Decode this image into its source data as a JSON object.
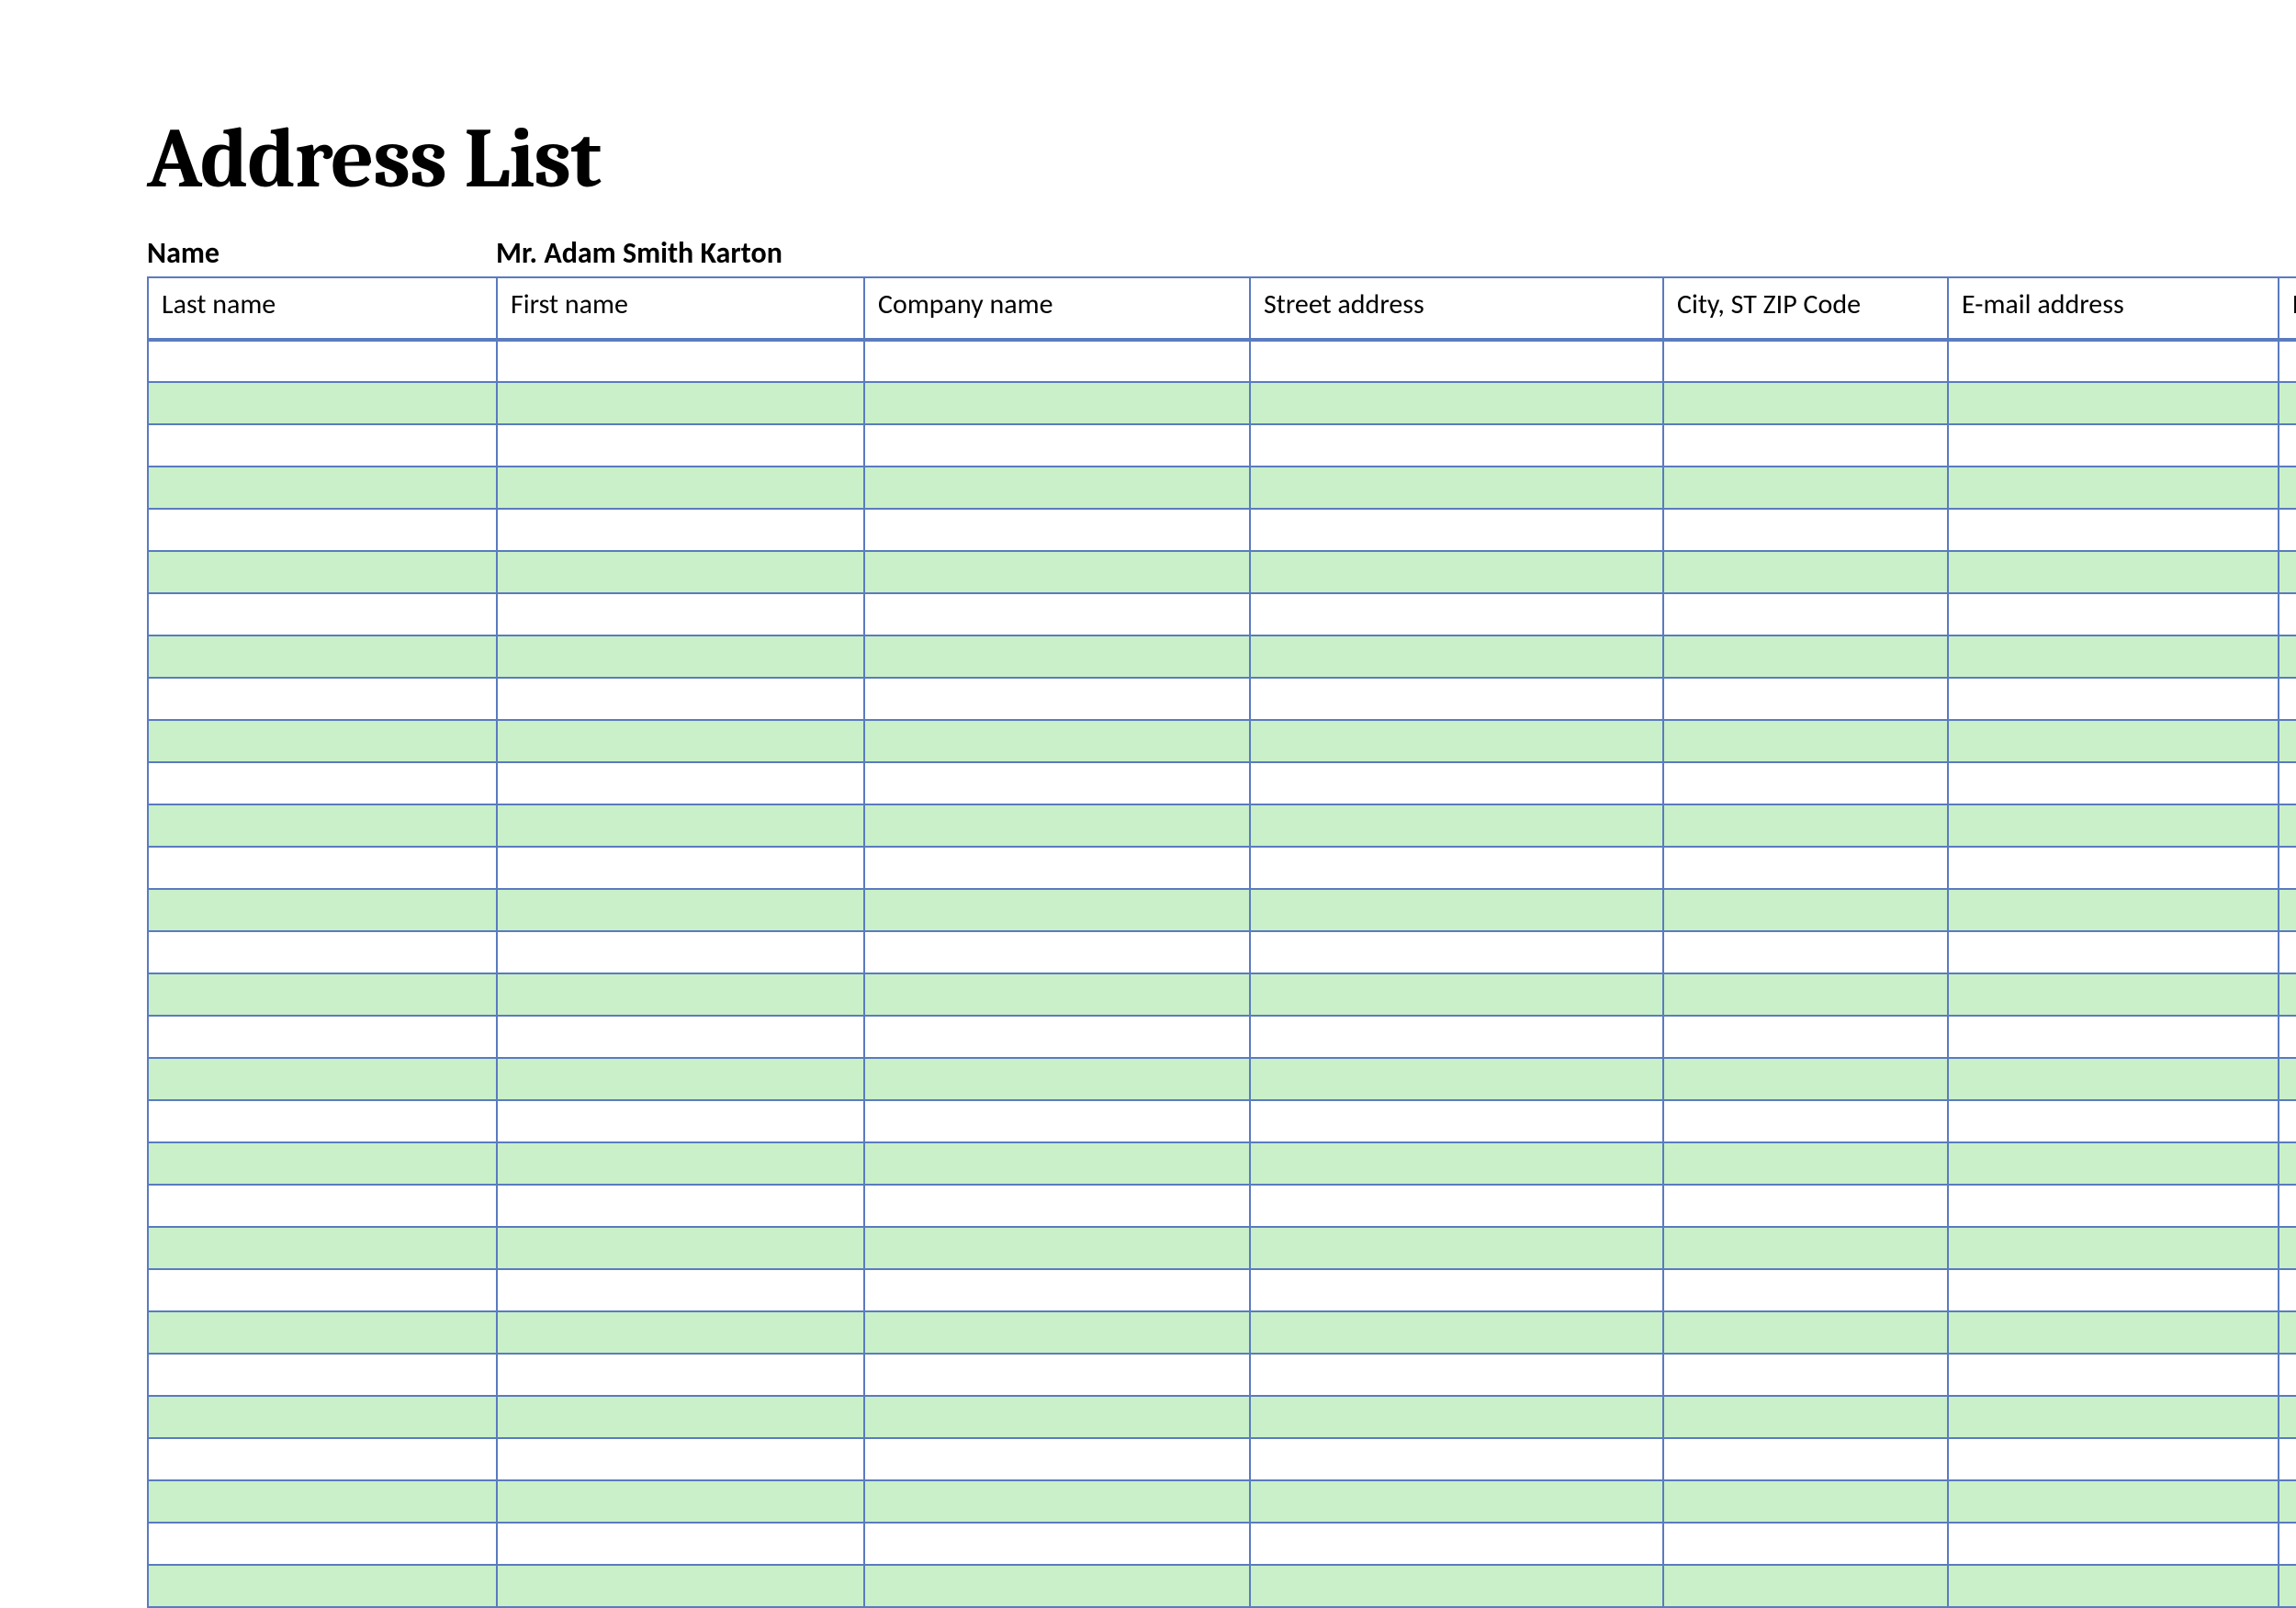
{
  "title": "Address List",
  "name_field": {
    "label": "Name",
    "value": "Mr. Adam Smith Karton"
  },
  "columns": [
    "Last name",
    "First name",
    "Company name",
    "Street address",
    "City, ST  ZIP Code",
    "E-mail address",
    "Home"
  ],
  "row_count": 30,
  "rows": [
    [
      "",
      "",
      "",
      "",
      "",
      "",
      ""
    ],
    [
      "",
      "",
      "",
      "",
      "",
      "",
      ""
    ],
    [
      "",
      "",
      "",
      "",
      "",
      "",
      ""
    ],
    [
      "",
      "",
      "",
      "",
      "",
      "",
      ""
    ],
    [
      "",
      "",
      "",
      "",
      "",
      "",
      ""
    ],
    [
      "",
      "",
      "",
      "",
      "",
      "",
      ""
    ],
    [
      "",
      "",
      "",
      "",
      "",
      "",
      ""
    ],
    [
      "",
      "",
      "",
      "",
      "",
      "",
      ""
    ],
    [
      "",
      "",
      "",
      "",
      "",
      "",
      ""
    ],
    [
      "",
      "",
      "",
      "",
      "",
      "",
      ""
    ],
    [
      "",
      "",
      "",
      "",
      "",
      "",
      ""
    ],
    [
      "",
      "",
      "",
      "",
      "",
      "",
      ""
    ],
    [
      "",
      "",
      "",
      "",
      "",
      "",
      ""
    ],
    [
      "",
      "",
      "",
      "",
      "",
      "",
      ""
    ],
    [
      "",
      "",
      "",
      "",
      "",
      "",
      ""
    ],
    [
      "",
      "",
      "",
      "",
      "",
      "",
      ""
    ],
    [
      "",
      "",
      "",
      "",
      "",
      "",
      ""
    ],
    [
      "",
      "",
      "",
      "",
      "",
      "",
      ""
    ],
    [
      "",
      "",
      "",
      "",
      "",
      "",
      ""
    ],
    [
      "",
      "",
      "",
      "",
      "",
      "",
      ""
    ],
    [
      "",
      "",
      "",
      "",
      "",
      "",
      ""
    ],
    [
      "",
      "",
      "",
      "",
      "",
      "",
      ""
    ],
    [
      "",
      "",
      "",
      "",
      "",
      "",
      ""
    ],
    [
      "",
      "",
      "",
      "",
      "",
      "",
      ""
    ],
    [
      "",
      "",
      "",
      "",
      "",
      "",
      ""
    ],
    [
      "",
      "",
      "",
      "",
      "",
      "",
      ""
    ],
    [
      "",
      "",
      "",
      "",
      "",
      "",
      ""
    ],
    [
      "",
      "",
      "",
      "",
      "",
      "",
      ""
    ],
    [
      "",
      "",
      "",
      "",
      "",
      "",
      ""
    ],
    [
      "",
      "",
      "",
      "",
      "",
      "",
      ""
    ]
  ]
}
